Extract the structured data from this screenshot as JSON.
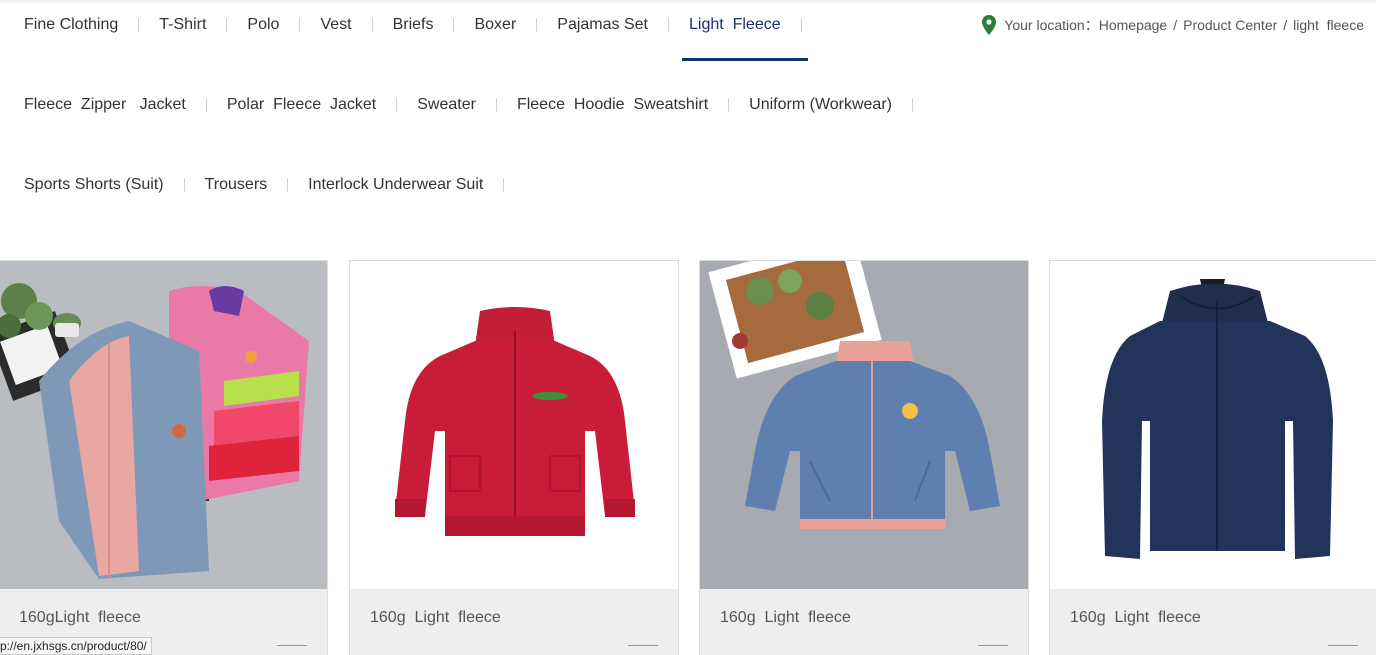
{
  "categories": {
    "row1": [
      "Fine Clothing",
      "T-Shirt",
      "Polo",
      "Vest",
      "Briefs",
      "Boxer",
      "Pajamas Set",
      "Light  Fleece"
    ],
    "row2": [
      "Fleece  Zipper   Jacket",
      "Polar  Fleece  Jacket",
      "Sweater",
      "Fleece  Hoodie  Sweatshirt",
      "Uniform (Workwear)"
    ],
    "row3": [
      "Sports Shorts (Suit)",
      "Trousers",
      "Interlock Underwear Suit"
    ],
    "active": "Light  Fleece"
  },
  "breadcrumb": {
    "icon": "location-pin-icon",
    "label": "Your location：",
    "items": [
      "Homepage",
      "Product Center",
      "light  fleece"
    ],
    "separator": "/"
  },
  "products": [
    {
      "title": "160gLight  fleece",
      "image": "fleece-vests-pile"
    },
    {
      "title": "160g  Light  fleece",
      "image": "red-fleece-jacket"
    },
    {
      "title": "160g  Light  fleece",
      "image": "blue-fleece-jacket"
    },
    {
      "title": "160g  Light  fleece",
      "image": "navy-fleece-hoodie"
    }
  ],
  "status_url": "p://en.jxhsgs.cn/product/80/",
  "colors": {
    "accent": "#1b2f6e",
    "pin": "#2e7d3a",
    "caption_bg": "#eeeeee"
  }
}
